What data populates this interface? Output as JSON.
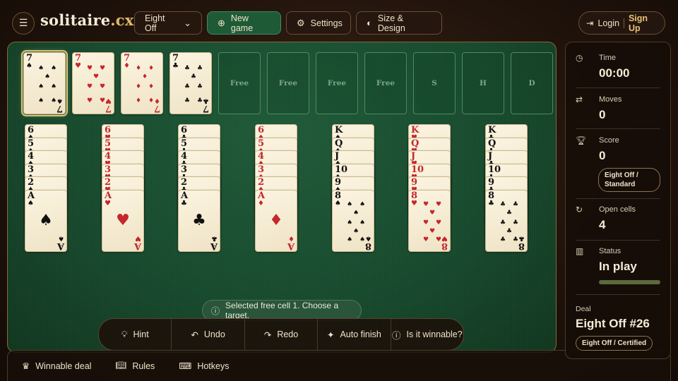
{
  "header": {
    "logo_main": "solitaire",
    "logo_tld": ".cx",
    "variant_select": "Eight Off",
    "new_game": "New game",
    "settings": "Settings",
    "size_design": "Size & Design",
    "login": "Login",
    "signup": "Sign Up"
  },
  "foundations": {
    "freecells": [
      {
        "rank": "7",
        "suit": "♠",
        "color": "black"
      },
      {
        "rank": "7",
        "suit": "♥",
        "color": "red"
      },
      {
        "rank": "7",
        "suit": "♦",
        "color": "red"
      },
      {
        "rank": "7",
        "suit": "♣",
        "color": "black"
      }
    ],
    "empty_slots": [
      "Free",
      "Free",
      "Free",
      "Free",
      "S",
      "H",
      "D"
    ]
  },
  "tableau": [
    {
      "suit": "♠",
      "color": "black",
      "ranks": [
        "6",
        "5",
        "4",
        "3",
        "2",
        "A"
      ]
    },
    {
      "suit": "♥",
      "color": "red",
      "ranks": [
        "6",
        "5",
        "4",
        "3",
        "2",
        "A"
      ]
    },
    {
      "suit": "♣",
      "color": "black",
      "ranks": [
        "6",
        "5",
        "4",
        "3",
        "2",
        "A"
      ]
    },
    {
      "suit": "♦",
      "color": "red",
      "ranks": [
        "6",
        "5",
        "4",
        "3",
        "2",
        "A"
      ]
    },
    {
      "suit": "♠",
      "color": "black",
      "ranks": [
        "K",
        "Q",
        "J",
        "10",
        "9",
        "8"
      ]
    },
    {
      "suit": "♥",
      "color": "red",
      "ranks": [
        "K",
        "Q",
        "J",
        "10",
        "9",
        "8"
      ]
    },
    {
      "suit": "♣",
      "color": "black",
      "ranks": [
        "K",
        "Q",
        "J",
        "10",
        "9",
        "8"
      ]
    }
  ],
  "toast": "Selected free cell 1. Choose a target.",
  "actions": {
    "hint": "Hint",
    "undo": "Undo",
    "redo": "Redo",
    "auto_finish": "Auto finish",
    "winnable": "Is it winnable?"
  },
  "footer": {
    "winnable_deal": "Winnable deal",
    "rules": "Rules",
    "hotkeys": "Hotkeys"
  },
  "sidebar": {
    "time_label": "Time",
    "time_value": "00:00",
    "moves_label": "Moves",
    "moves_value": "0",
    "score_label": "Score",
    "score_value": "0",
    "score_tag": "Eight Off / Standard",
    "open_cells_label": "Open cells",
    "open_cells_value": "4",
    "status_label": "Status",
    "status_value": "In play",
    "status_progress": 1.0,
    "deal_label": "Deal",
    "deal_value": "Eight Off #26",
    "deal_tag": "Eight Off / Certified"
  },
  "colors": {
    "accent_green": "#1e5a36",
    "felt": "#184a2e",
    "gold": "#e8c27a",
    "red_suit": "#c4272d"
  }
}
